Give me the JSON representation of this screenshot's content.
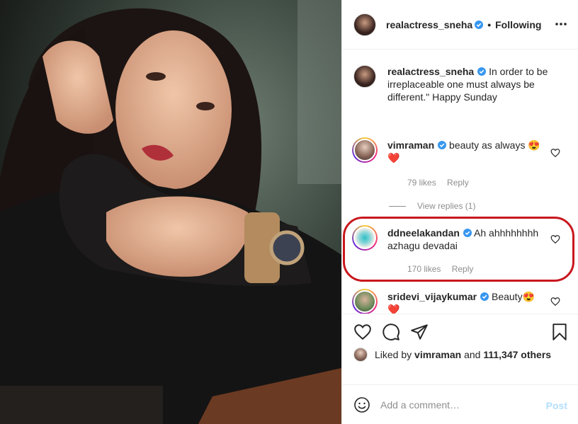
{
  "post": {
    "author": "realactress_sneha",
    "follow_status": "Following",
    "dot": "•"
  },
  "caption": {
    "author": "realactress_sneha",
    "text": "In order to be irreplaceable one must always be different.\" Happy Sunday"
  },
  "comments": [
    {
      "user": "vimraman",
      "text": "beauty as always 😍 ❤️",
      "likes": "79 likes",
      "reply": "Reply",
      "view_replies": "View replies (1)"
    },
    {
      "user": "ddneelakandan",
      "text": "Ah ahhhhhhhh azhagu devadai",
      "likes": "170 likes",
      "reply": "Reply"
    },
    {
      "user": "sridevi_vijaykumar",
      "text": "Beauty😍 ❤️"
    }
  ],
  "likes_summary": {
    "prefix": "Liked by",
    "user": "vimraman",
    "conj": "and",
    "others": "111,347 others"
  },
  "comment_box": {
    "placeholder": "Add a comment…",
    "post_label": "Post"
  },
  "colors": {
    "verified": "#3897f0",
    "highlight": "#c8181e",
    "post_button": "#b2dffc"
  },
  "icons": [
    "more-options-icon",
    "verified-badge-icon",
    "heart-icon",
    "comment-icon",
    "share-icon",
    "bookmark-icon",
    "emoji-icon"
  ]
}
